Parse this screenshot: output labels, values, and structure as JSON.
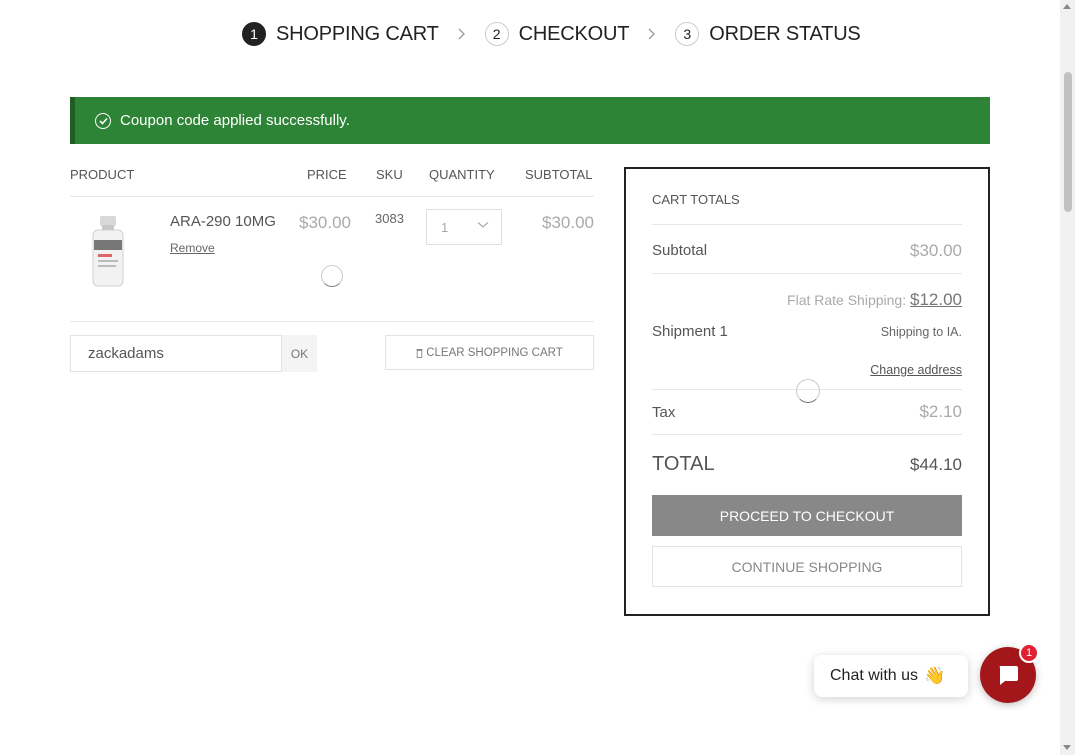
{
  "steps": [
    {
      "num": "1",
      "label": "SHOPPING CART"
    },
    {
      "num": "2",
      "label": "CHECKOUT"
    },
    {
      "num": "3",
      "label": "ORDER STATUS"
    }
  ],
  "notice": {
    "text": "Coupon code applied successfully.",
    "color": "#2e8436"
  },
  "cart": {
    "headers": {
      "product": "PRODUCT",
      "price": "PRICE",
      "sku": "SKU",
      "quantity": "QUANTITY",
      "subtotal": "SUBTOTAL"
    },
    "items": [
      {
        "name": "ARA-290 10MG",
        "remove": "Remove",
        "price": "$30.00",
        "sku": "3083",
        "quantity": "1",
        "subtotal": "$30.00"
      }
    ],
    "coupon_value": "zackadams",
    "ok_label": "OK",
    "clear_label": "CLEAR SHOPPING CART"
  },
  "totals": {
    "title": "CART TOTALS",
    "subtotal_label": "Subtotal",
    "subtotal_value": "$30.00",
    "shipment_label": "Shipment 1",
    "shipping_text": "Flat Rate Shipping:",
    "shipping_amount": "$12.00",
    "shipping_to": "Shipping to IA.",
    "change_address": "Change address",
    "tax_label": "Tax",
    "tax_value": "$2.10",
    "total_label": "TOTAL",
    "total_value": "$44.10",
    "checkout_label": "PROCEED TO CHECKOUT",
    "continue_label": "CONTINUE SHOPPING"
  },
  "chat": {
    "label": "Chat with us",
    "emoji": "👋",
    "badge": "1",
    "button_color": "#a3171b"
  }
}
